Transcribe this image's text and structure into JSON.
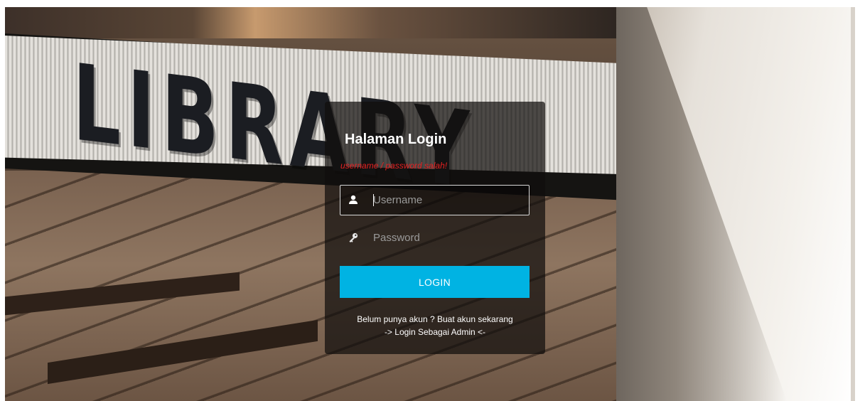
{
  "background": {
    "sign_text": "LIBRARY"
  },
  "login": {
    "title": "Halaman Login",
    "error_message": "username / password salah!",
    "username": {
      "value": "",
      "placeholder": "Username",
      "icon": "user-icon"
    },
    "password": {
      "value": "",
      "placeholder": "Password",
      "icon": "key-icon"
    },
    "submit_label": "LOGIN",
    "register_link": "Belum punya akun ? Buat akun sekarang",
    "admin_link": "-> Login Sebagai Admin <-"
  },
  "colors": {
    "accent": "#00b3e3",
    "error": "#e62020",
    "card_bg": "rgba(16,14,12,0.72)"
  }
}
